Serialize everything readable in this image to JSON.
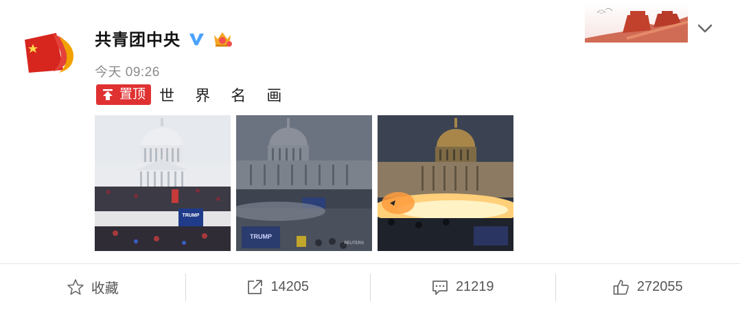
{
  "post": {
    "author": "共青团中央",
    "timestamp": "今天 09:26",
    "pin_label": "置顶",
    "text": "世 界 名 画",
    "photos": [
      "capitol-crowd-photo",
      "capitol-smoke-photo",
      "capitol-explosion-photo"
    ],
    "photo_texts": {
      "trump_banner": "TRUMP",
      "reuters_mark": "REUTERS"
    }
  },
  "actions": {
    "favorite_label": "收藏",
    "repost_count": "14205",
    "comment_count": "21219",
    "like_count": "272055"
  },
  "icons": [
    "verified-icon",
    "crown-icon",
    "chevron-down-icon",
    "pin-icon",
    "star-icon",
    "share-icon",
    "comment-icon",
    "thumbs-up-icon"
  ],
  "colors": {
    "pin_red": "#e03131",
    "verified_blue": "#4aa3ff",
    "muted_text": "#8a8a8a"
  }
}
